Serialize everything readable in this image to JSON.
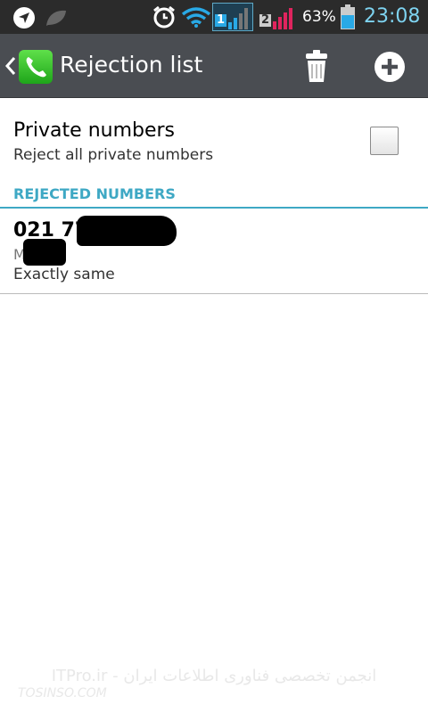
{
  "status_bar": {
    "icons": [
      "navigation-icon",
      "leaf-icon",
      "alarm-icon",
      "wifi-icon",
      "sim1-signal-icon",
      "sim2-signal-icon",
      "battery-icon"
    ],
    "sim1_label": "1",
    "sim2_label": "2",
    "battery_percent": "63%",
    "time": "23:08",
    "colors": {
      "background": "#2b2b2b",
      "time": "#7ed3f0",
      "sim1": "#29a9e6",
      "sim2": "#e0245e"
    }
  },
  "action_bar": {
    "title": "Rejection list",
    "icons": [
      "back-chevron-icon",
      "phone-app-icon",
      "trash-icon",
      "add-icon"
    ]
  },
  "private_numbers": {
    "title": "Private numbers",
    "subtitle": "Reject all private numbers",
    "checked": false
  },
  "rejected_section": {
    "header": "REJECTED NUMBERS",
    "accent": "#3ea8c4",
    "entries": [
      {
        "number": "021 77",
        "name": "M",
        "match": "Exactly same"
      }
    ]
  },
  "watermark": {
    "line1": "ITPro.ir - انجمن تخصصی فناوری اطلاعات ایران",
    "line2": "TOSINSO.COM"
  }
}
